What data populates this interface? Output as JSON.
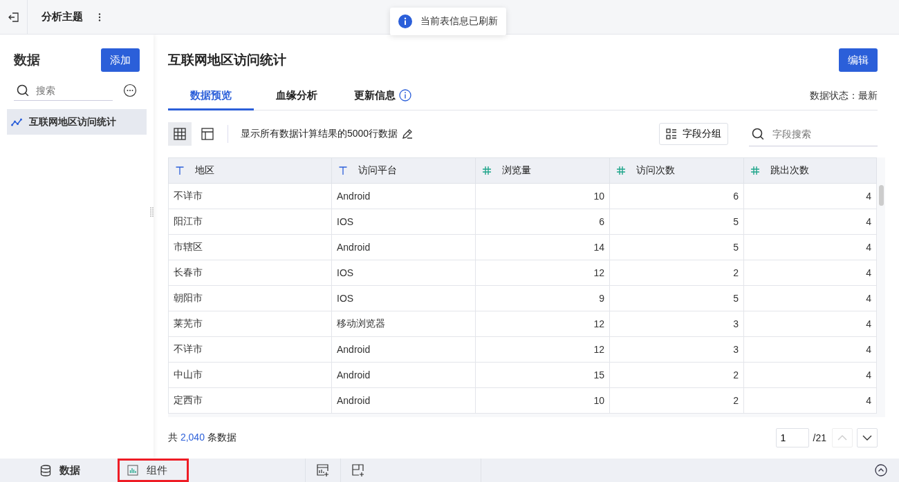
{
  "top_bar": {
    "title": "分析主题"
  },
  "toast": {
    "message": "当前表信息已刷新"
  },
  "sidebar": {
    "title": "数据",
    "add_button": "添加",
    "search": {
      "placeholder": "搜索"
    },
    "items": [
      {
        "label": "互联网地区访问统计",
        "selected": true
      }
    ]
  },
  "main": {
    "title": "互联网地区访问统计",
    "edit_button": "编辑",
    "tabs": [
      {
        "label": "数据预览",
        "selected": true,
        "info": false
      },
      {
        "label": "血缘分析",
        "selected": false,
        "info": false
      },
      {
        "label": "更新信息",
        "selected": false,
        "info": true
      }
    ],
    "data_status": "数据状态：最新",
    "views": [
      {
        "kind": "grid",
        "selected": true
      },
      {
        "kind": "layout",
        "selected": false
      }
    ],
    "description": "显示所有数据计算结果的5000行数据",
    "group_button": "字段分组",
    "field_search": {
      "placeholder": "字段搜索"
    }
  },
  "table": {
    "columns": [
      {
        "label": "地区",
        "kind": "text"
      },
      {
        "label": "访问平台",
        "kind": "text"
      },
      {
        "label": "浏览量",
        "kind": "number"
      },
      {
        "label": "访问次数",
        "kind": "number"
      },
      {
        "label": "跳出次数",
        "kind": "number"
      }
    ],
    "rows": [
      [
        "不详市",
        "Android",
        "10",
        "6",
        "4"
      ],
      [
        "阳江市",
        "IOS",
        "6",
        "5",
        "4"
      ],
      [
        "市辖区",
        "Android",
        "14",
        "5",
        "4"
      ],
      [
        "长春市",
        "IOS",
        "12",
        "2",
        "4"
      ],
      [
        "朝阳市",
        "IOS",
        "9",
        "5",
        "4"
      ],
      [
        "莱芜市",
        "移动浏览器",
        "12",
        "3",
        "4"
      ],
      [
        "不详市",
        "Android",
        "12",
        "3",
        "4"
      ],
      [
        "中山市",
        "Android",
        "15",
        "2",
        "4"
      ],
      [
        "定西市",
        "Android",
        "10",
        "2",
        "4"
      ]
    ]
  },
  "footer": {
    "total_prefix": "共",
    "total_count": "2,040",
    "total_suffix": "条数据",
    "page": "1",
    "page_total": "/21",
    "prev_disabled": true,
    "next_disabled": false
  },
  "bottom_bar": {
    "tabs": [
      {
        "label": "数据",
        "kind": "data",
        "selected": true,
        "highlighted": false
      },
      {
        "label": "组件",
        "kind": "chart",
        "selected": false,
        "highlighted": true
      }
    ]
  }
}
